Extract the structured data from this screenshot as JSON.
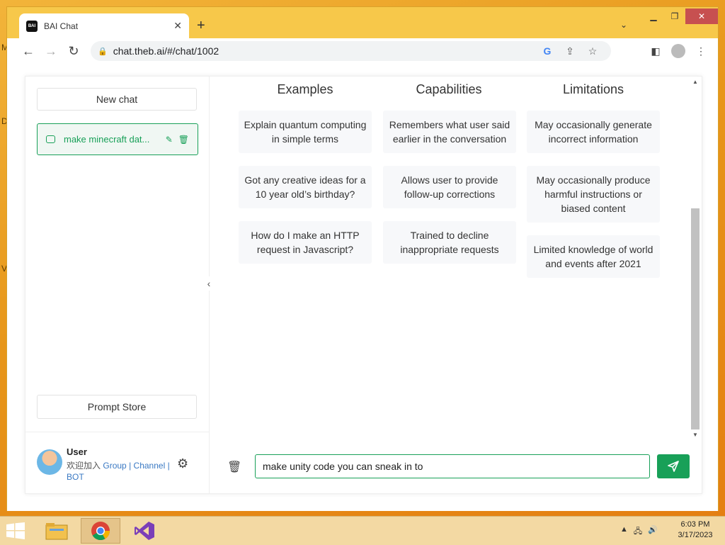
{
  "desktop": {
    "edge_letters": [
      "M",
      "D",
      "V"
    ]
  },
  "browser": {
    "tab_title": "BAI Chat",
    "tab_favicon_text": "BAI",
    "url": "chat.theb.ai/#/chat/1002"
  },
  "sidebar": {
    "new_chat_label": "New chat",
    "chat_items": [
      {
        "label": "make minecraft dat..."
      }
    ],
    "prompt_store_label": "Prompt Store",
    "user": {
      "name": "User",
      "desc_prefix": "欢迎加入",
      "group_link": "Group",
      "sep1": "|",
      "channel_link": "Channel",
      "sep2": "|",
      "bot_link": "BOT"
    }
  },
  "main": {
    "columns": [
      {
        "title": "Examples",
        "cards": [
          "Explain quantum computing in simple terms",
          "Got any creative ideas for a 10 year old’s birthday?",
          "How do I make an HTTP request in Javascript?"
        ]
      },
      {
        "title": "Capabilities",
        "cards": [
          "Remembers what user said earlier in the conversation",
          "Allows user to provide follow-up corrections",
          "Trained to decline inappropriate requests"
        ]
      },
      {
        "title": "Limitations",
        "cards": [
          "May occasionally generate incorrect information",
          "May occasionally produce harmful instructions or biased content",
          "Limited knowledge of world and events after 2021"
        ]
      }
    ],
    "input_value": "make unity code you can sneak in to"
  },
  "taskbar": {
    "time": "6:03 PM",
    "date": "3/17/2023"
  },
  "colors": {
    "accent": "#18a058",
    "link": "#3a79c3"
  }
}
